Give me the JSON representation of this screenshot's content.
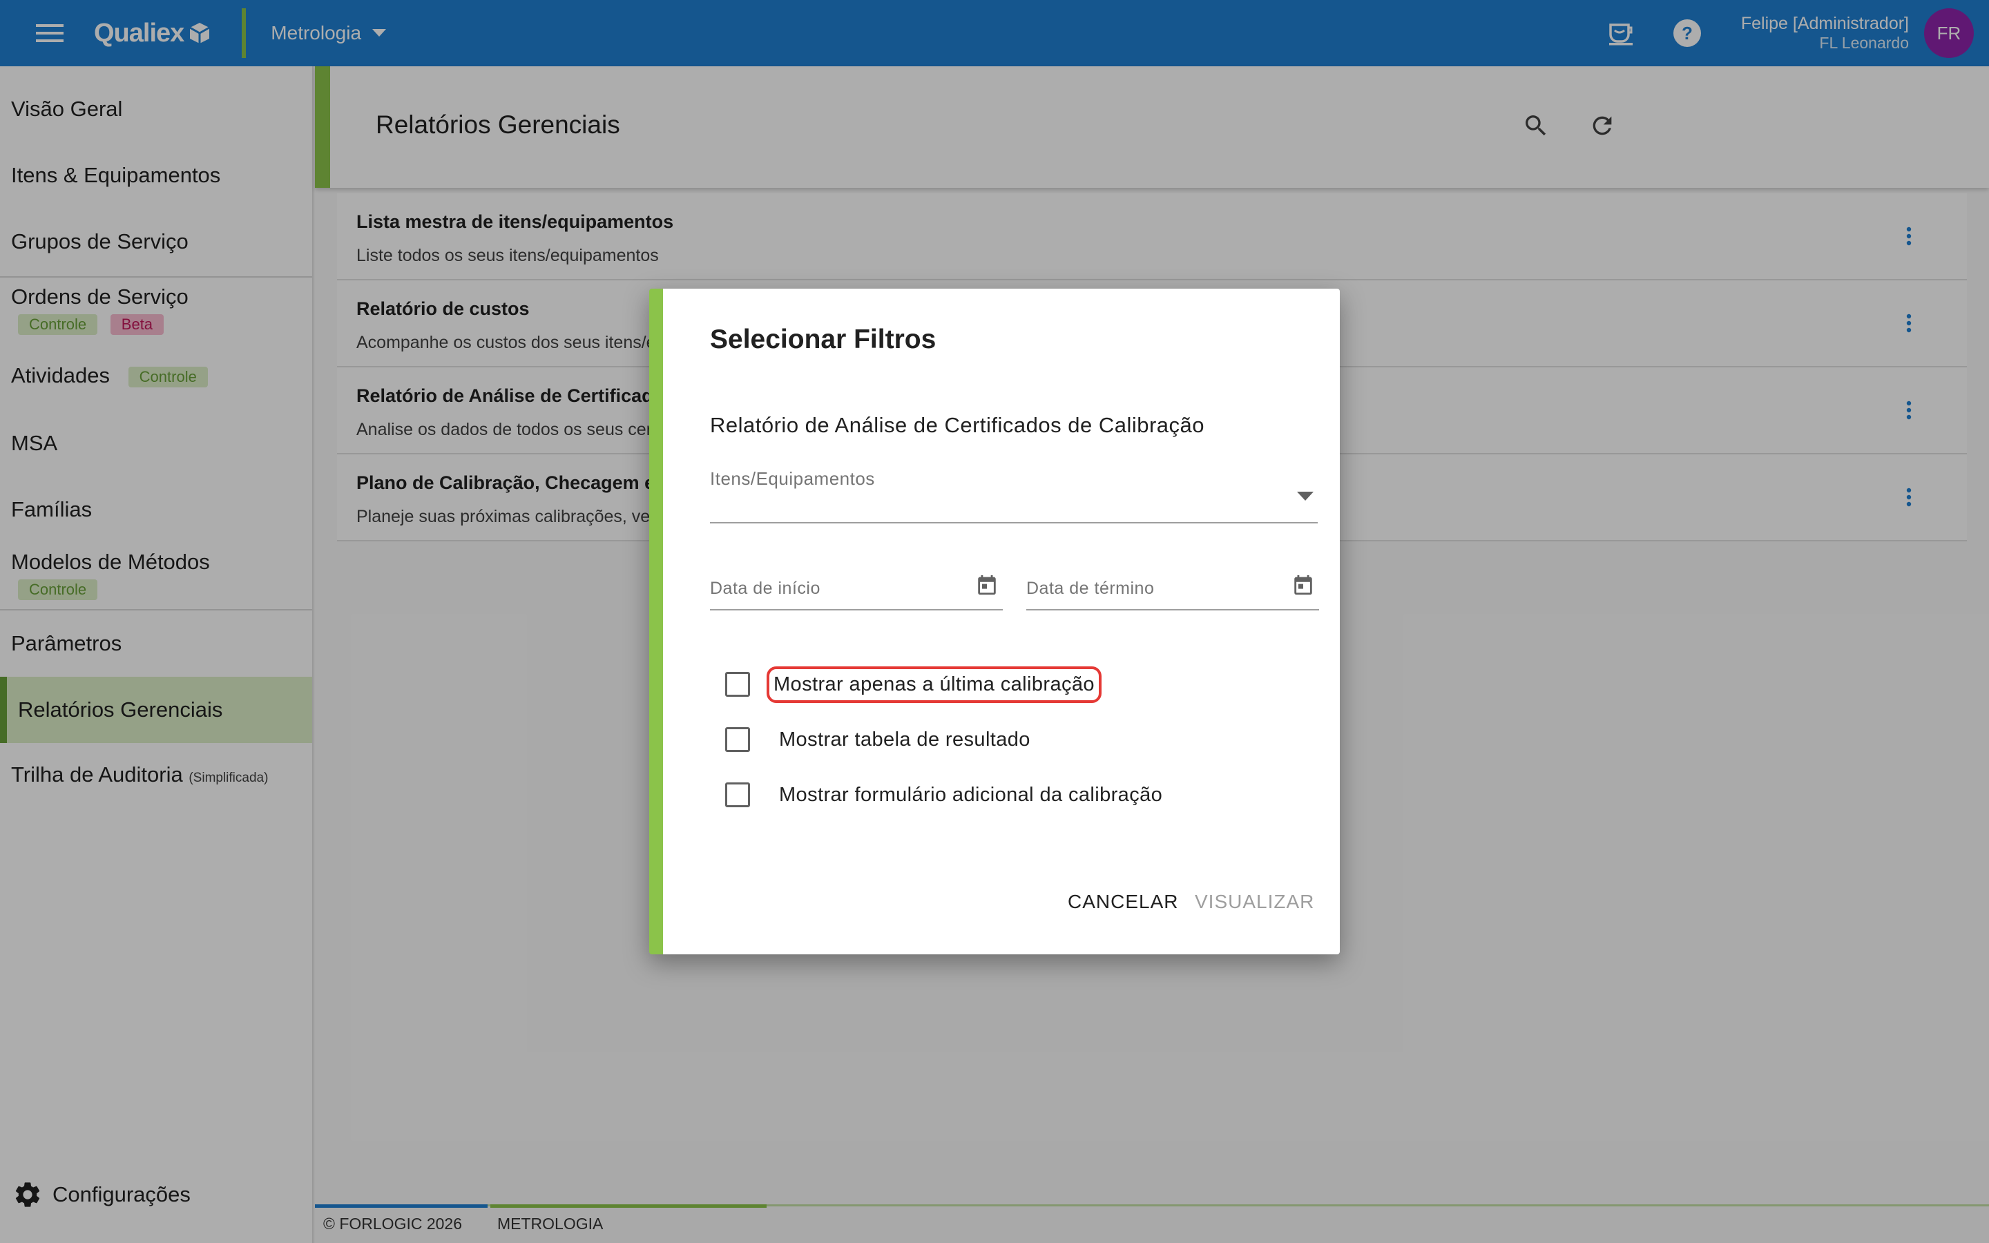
{
  "topbar": {
    "brand": "Qualiex",
    "module": "Metrologia",
    "user_name": "Felipe [Administrador]",
    "user_org": "FL Leonardo",
    "avatar_initials": "FR"
  },
  "sidebar": {
    "items": [
      {
        "label": "Visão Geral"
      },
      {
        "label": "Itens & Equipamentos"
      },
      {
        "label": "Grupos de Serviço"
      },
      {
        "label": "Ordens de Serviço",
        "badges": [
          "Controle",
          "Beta"
        ]
      },
      {
        "label": "Atividades",
        "badges": [
          "Controle"
        ]
      },
      {
        "label": "MSA"
      },
      {
        "label": "Famílias"
      },
      {
        "label": "Modelos de Métodos",
        "badges": [
          "Controle"
        ]
      },
      {
        "label": "Parâmetros"
      },
      {
        "label": "Relatórios Gerenciais"
      },
      {
        "label": "Trilha de Auditoria",
        "note": "(Simplificada)"
      }
    ],
    "settings_label": "Configurações"
  },
  "main": {
    "title": "Relatórios Gerenciais",
    "reports": [
      {
        "title": "Lista mestra de itens/equipamentos",
        "desc": "Liste todos os seus itens/equipamentos"
      },
      {
        "title": "Relatório de custos",
        "desc": "Acompanhe os custos dos seus itens/e"
      },
      {
        "title": "Relatório de Análise de Certificad",
        "desc": "Analise os dados de todos os seus cert"
      },
      {
        "title": "Plano de Calibração, Checagem e",
        "desc": "Planeje suas próximas calibrações, veri"
      }
    ]
  },
  "footer": {
    "copyright": "© FORLOGIC 2026",
    "module": "METROLOGIA"
  },
  "dialog": {
    "title": "Selecionar Filtros",
    "subtitle": "Relatório de Análise de Certificados de Calibração",
    "items_placeholder": "Itens/Equipamentos",
    "start_date_placeholder": "Data de início",
    "end_date_placeholder": "Data de término",
    "checkboxes": [
      {
        "label": "Mostrar apenas a última calibração",
        "checked": false
      },
      {
        "label": "Mostrar tabela de resultado",
        "checked": false
      },
      {
        "label": "Mostrar formulário adicional da calibração",
        "checked": false
      }
    ],
    "cancel_label": "CANCELAR",
    "view_label": "VISUALIZAR"
  },
  "colors": {
    "primary": "#1f7fd2",
    "accent": "#8bc34a",
    "highlight": "#e53935",
    "avatar": "#8e24aa"
  }
}
